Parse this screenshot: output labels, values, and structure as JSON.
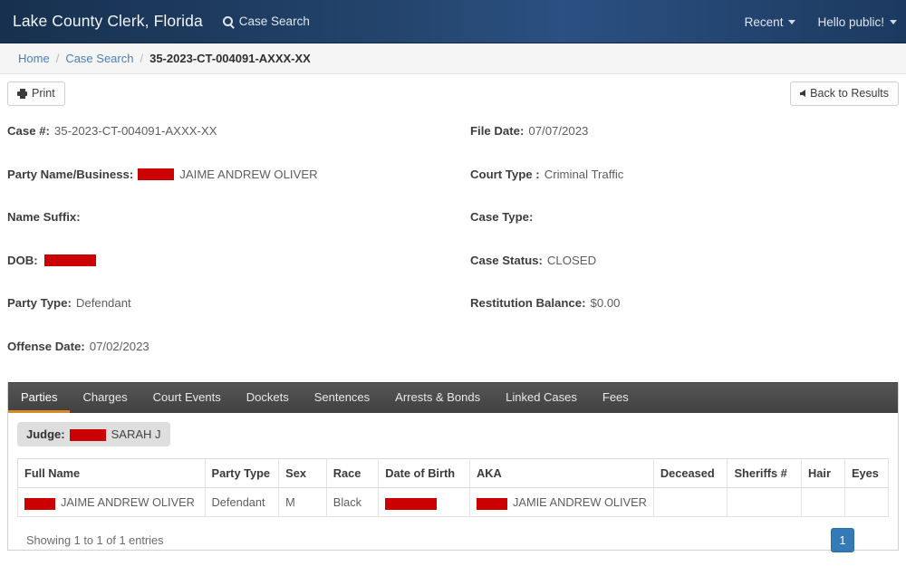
{
  "navbar": {
    "brand": "Lake County Clerk, Florida",
    "case_search_label": "Case Search",
    "search_icon": "search-icon",
    "recent_label": "Recent",
    "greeting_label": "Hello public!"
  },
  "breadcrumb": {
    "home": "Home",
    "case_search": "Case Search",
    "separator": "/",
    "current": "35-2023-CT-004091-AXXX-XX"
  },
  "actions": {
    "print_label": "Print",
    "print_icon": "printer-icon",
    "back_label": "Back to Results",
    "back_icon": "arrow-left-icon"
  },
  "case_fields": [
    {
      "label": "Case #:",
      "value": "35-2023-CT-004091-AXXX-XX",
      "redacted": false
    },
    {
      "label": "File Date:",
      "value": "07/07/2023",
      "redacted": false
    },
    {
      "label": "Party Name/Business:",
      "value": "JAIME ANDREW OLIVER",
      "redacted": true
    },
    {
      "label": "Court Type :",
      "value": "Criminal Traffic",
      "redacted": false
    },
    {
      "label": "Name Suffix:",
      "value": "",
      "redacted": false
    },
    {
      "label": "Case Type:",
      "value": "",
      "redacted": false
    },
    {
      "label": "DOB:",
      "value": "",
      "redacted": true
    },
    {
      "label": "Case Status:",
      "value": "CLOSED",
      "redacted": false
    },
    {
      "label": "Party Type:",
      "value": "Defendant",
      "redacted": false
    },
    {
      "label": "Restitution Balance:",
      "value": "$0.00",
      "redacted": false
    },
    {
      "label": "Offense Date:",
      "value": "07/02/2023",
      "redacted": false
    },
    {
      "label": "",
      "value": "",
      "redacted": false
    }
  ],
  "tabs": [
    {
      "label": "Parties",
      "active": true
    },
    {
      "label": "Charges",
      "active": false
    },
    {
      "label": "Court Events",
      "active": false
    },
    {
      "label": "Dockets",
      "active": false
    },
    {
      "label": "Sentences",
      "active": false
    },
    {
      "label": "Arrests & Bonds",
      "active": false
    },
    {
      "label": "Linked Cases",
      "active": false
    },
    {
      "label": "Fees",
      "active": false
    }
  ],
  "judge": {
    "label": "Judge:",
    "value": "SARAH J",
    "redacted": true
  },
  "parties_table": {
    "columns": [
      "Full Name",
      "Party Type",
      "Sex",
      "Race",
      "Date of Birth",
      "AKA",
      "Deceased",
      "Sheriffs #",
      "Hair",
      "Eyes"
    ],
    "rows": [
      {
        "full_name": "JAIME ANDREW OLIVER",
        "party_type": "Defendant",
        "sex": "M",
        "race": "Black",
        "date_of_birth": "",
        "aka": "JAMIE ANDREW OLIVER",
        "deceased": "",
        "sheriffs_number": "",
        "hair": "",
        "eyes": ""
      }
    ]
  },
  "footer": {
    "showing_text": "Showing 1 to 1 of 1 entries",
    "page_number": "1"
  },
  "colors": {
    "navbar": "#1d3557",
    "tabbar": "#4a4a4a",
    "accent_tab": "#d98b2b",
    "redaction": "#cc0000",
    "pager": "#337ab7",
    "link": "#4a7fb5"
  }
}
